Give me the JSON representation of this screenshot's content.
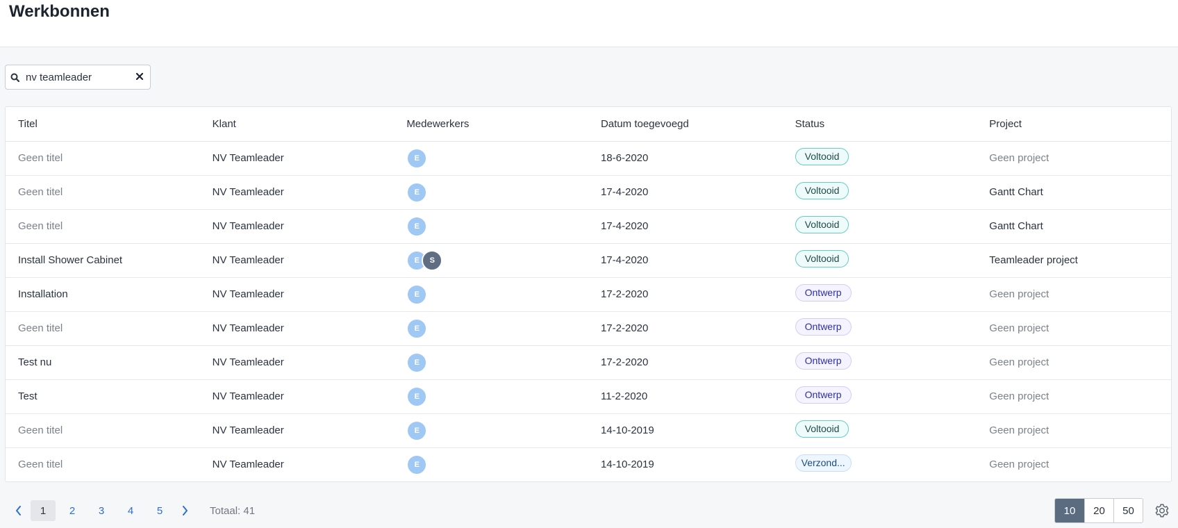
{
  "header": {
    "title": "Werkbonnen"
  },
  "search": {
    "value": "nv teamleader",
    "icon": "search-icon",
    "clear_icon": "close-icon"
  },
  "table": {
    "columns": [
      "Titel",
      "Klant",
      "Medewerkers",
      "Datum toegevoegd",
      "Status",
      "Project"
    ],
    "rows": [
      {
        "title": "Geen titel",
        "title_muted": true,
        "client": "NV Teamleader",
        "avatars": [
          "E"
        ],
        "date": "18-6-2020",
        "status": "Voltooid",
        "status_type": "voltooid",
        "project": "Geen project",
        "project_muted": true
      },
      {
        "title": "Geen titel",
        "title_muted": true,
        "client": "NV Teamleader",
        "avatars": [
          "E"
        ],
        "date": "17-4-2020",
        "status": "Voltooid",
        "status_type": "voltooid",
        "project": "Gantt Chart",
        "project_muted": false
      },
      {
        "title": "Geen titel",
        "title_muted": true,
        "client": "NV Teamleader",
        "avatars": [
          "E"
        ],
        "date": "17-4-2020",
        "status": "Voltooid",
        "status_type": "voltooid",
        "project": "Gantt Chart",
        "project_muted": false
      },
      {
        "title": "Install Shower Cabinet",
        "title_muted": false,
        "client": "NV Teamleader",
        "avatars": [
          "E",
          "S"
        ],
        "date": "17-4-2020",
        "status": "Voltooid",
        "status_type": "voltooid",
        "project": "Teamleader project",
        "project_muted": false
      },
      {
        "title": "Installation",
        "title_muted": false,
        "client": "NV Teamleader",
        "avatars": [
          "E"
        ],
        "date": "17-2-2020",
        "status": "Ontwerp",
        "status_type": "ontwerp",
        "project": "Geen project",
        "project_muted": true
      },
      {
        "title": "Geen titel",
        "title_muted": true,
        "client": "NV Teamleader",
        "avatars": [
          "E"
        ],
        "date": "17-2-2020",
        "status": "Ontwerp",
        "status_type": "ontwerp",
        "project": "Geen project",
        "project_muted": true
      },
      {
        "title": "Test nu",
        "title_muted": false,
        "client": "NV Teamleader",
        "avatars": [
          "E"
        ],
        "date": "17-2-2020",
        "status": "Ontwerp",
        "status_type": "ontwerp",
        "project": "Geen project",
        "project_muted": true
      },
      {
        "title": "Test",
        "title_muted": false,
        "client": "NV Teamleader",
        "avatars": [
          "E"
        ],
        "date": "11-2-2020",
        "status": "Ontwerp",
        "status_type": "ontwerp",
        "project": "Geen project",
        "project_muted": true
      },
      {
        "title": "Geen titel",
        "title_muted": true,
        "client": "NV Teamleader",
        "avatars": [
          "E"
        ],
        "date": "14-10-2019",
        "status": "Voltooid",
        "status_type": "voltooid",
        "project": "Geen project",
        "project_muted": true
      },
      {
        "title": "Geen titel",
        "title_muted": true,
        "client": "NV Teamleader",
        "avatars": [
          "E"
        ],
        "date": "14-10-2019",
        "status": "Verzond...",
        "status_type": "verzonden",
        "project": "Geen project",
        "project_muted": true
      }
    ]
  },
  "pagination": {
    "pages": [
      "1",
      "2",
      "3",
      "4",
      "5"
    ],
    "current": "1",
    "total_label": "Totaal: 41",
    "prev_icon": "chevron-left-icon",
    "next_icon": "chevron-right-icon"
  },
  "page_size": {
    "options": [
      "10",
      "20",
      "50"
    ],
    "selected": "10"
  },
  "settings_icon": "gear-icon",
  "colors": {
    "accent": "#2c6fd1",
    "selected_size": "#5b6c80",
    "voltooid_border": "#5fcfc6",
    "ontwerp_text": "#2d2faa"
  }
}
